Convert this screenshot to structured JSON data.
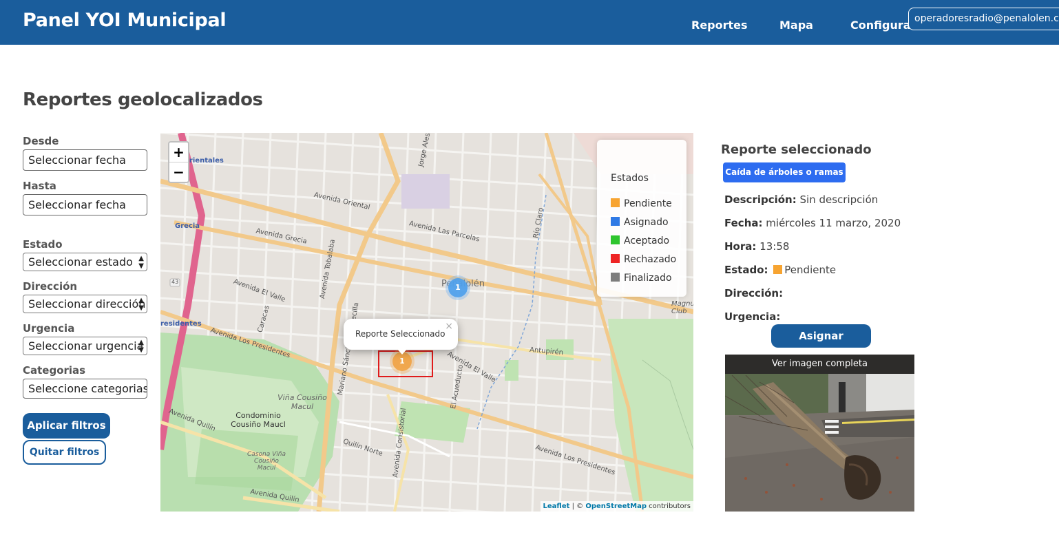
{
  "header": {
    "brand": "Panel YOI Municipal",
    "nav": [
      "Reportes",
      "Mapa",
      "Configuración"
    ],
    "user_email": "operadoresradio@penalolen.cl"
  },
  "page_title": "Reportes geolocalizados",
  "filters": {
    "desde_label": "Desde",
    "desde_placeholder": "Seleccionar fecha",
    "hasta_label": "Hasta",
    "hasta_placeholder": "Seleccionar fecha",
    "estado_label": "Estado",
    "estado_value": "Seleccionar estado",
    "direccion_label": "Dirección",
    "direccion_value": "Seleccionar dirección",
    "urgencia_label": "Urgencia",
    "urgencia_value": "Seleccionar urgencia",
    "categorias_label": "Categorias",
    "categorias_placeholder": "Seleccione categorias",
    "apply_label": "Aplicar filtros",
    "clear_label": "Quitar filtros"
  },
  "map": {
    "zoom_in": "+",
    "zoom_out": "−",
    "legend_title": "Estados",
    "legend": [
      {
        "label": "Pendiente",
        "color": "#f7a431"
      },
      {
        "label": "Asignado",
        "color": "#2f7ae5"
      },
      {
        "label": "Aceptado",
        "color": "#2ec52e"
      },
      {
        "label": "Rechazado",
        "color": "#ee2424"
      },
      {
        "label": "Finalizado",
        "color": "#7d7d7d"
      }
    ],
    "popup_text": "Reporte Seleccionado",
    "popup_close": "×",
    "marker_selected_count": "1",
    "marker_other_count": "1",
    "attribution_leaflet": "Leaflet",
    "attribution_sep": " | © ",
    "attribution_osm": "OpenStreetMap",
    "attribution_suffix": " contributors",
    "labels": {
      "orientales": "s Orientales",
      "grecia": "Grecia",
      "presidentes": "residentes",
      "penalolen": "Peñalolén",
      "av_oriental": "Avenida Oriental",
      "av_las_parcelas": "Avenida Las Parcelas",
      "av_grecia": "Avenida Grecia",
      "av_el_valle": "Avenida El Valle",
      "caracas": "Caracas",
      "av_los_presidentes": "Avenida Los Presidentes",
      "antupiren": "Antupirén",
      "av_el_valle2": "Avenida El Valle",
      "vina_cousino": "Viña Cousiño Macul",
      "condominio": "Condominio Cousiño Maucl",
      "av_quilin": "Avenida Quilín",
      "quilin_norte": "Quilín Norte",
      "casona": "Casona Viña Cousiño Macul",
      "av_quilin2": "Avenida Quilín",
      "tobalaba": "Avenida Tobalaba",
      "mariano": "Mariano Sánchez Fontecilla",
      "consistorial": "Avenida Consistorial",
      "acueducto": "El Acueducto",
      "rio_claro": "Río Claro",
      "jorge_alessandri": "Jorge Alessandri",
      "av_los_presidentes2": "Avenida Los Presidentes",
      "magnus": "Magnus Club",
      "route_43": "43"
    }
  },
  "detail": {
    "title": "Reporte seleccionado",
    "category": "Caída de árboles o ramas",
    "descripcion_label": "Descripción:",
    "descripcion_value": "Sin descripción",
    "fecha_label": "Fecha:",
    "fecha_value": "miércoles 11 marzo, 2020",
    "hora_label": "Hora:",
    "hora_value": "13:58",
    "estado_label": "Estado:",
    "estado_value": "Pendiente",
    "estado_color": "#f7a431",
    "direccion_label": "Dirección:",
    "urgencia_label": "Urgencia:",
    "assign_label": "Asignar",
    "image_caption": "Ver imagen completa"
  }
}
